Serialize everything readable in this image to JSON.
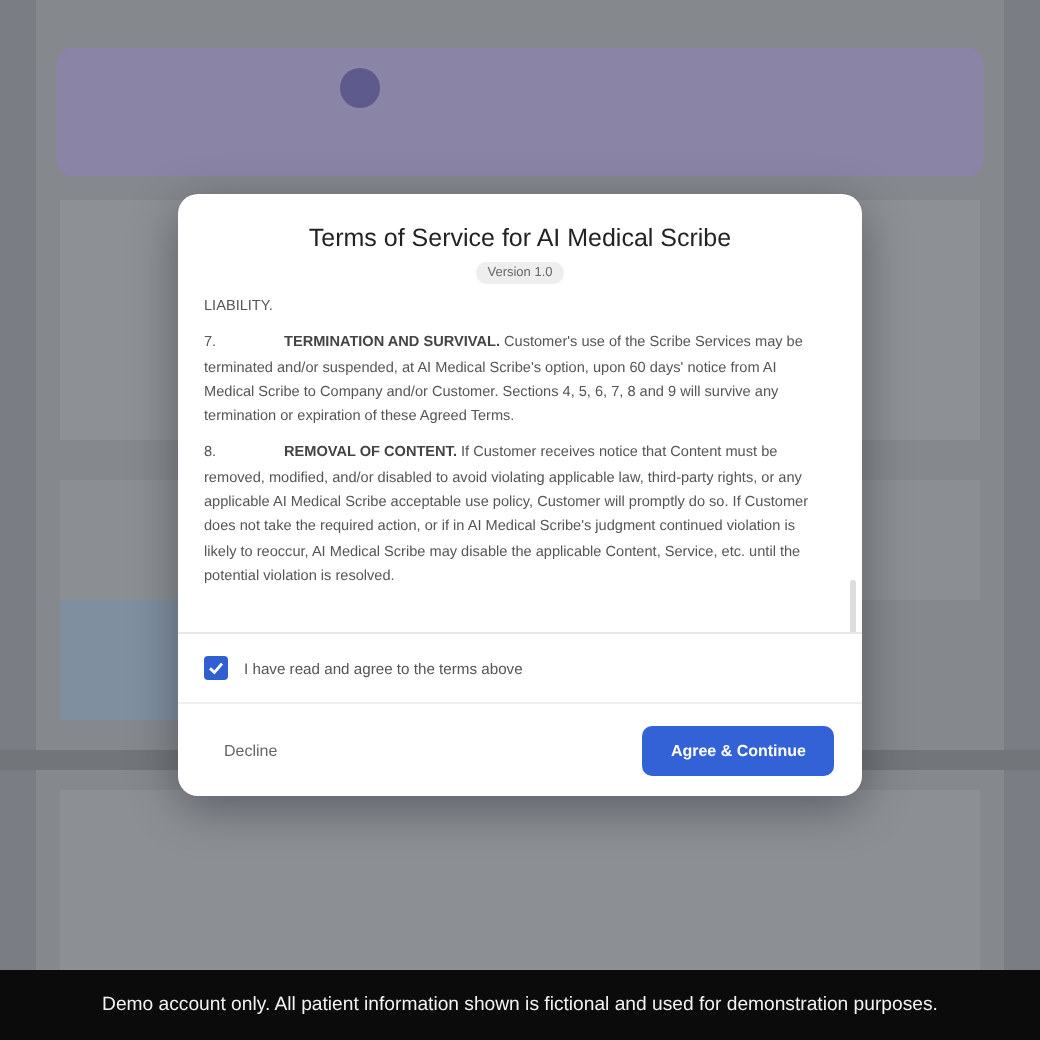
{
  "dialog": {
    "title": "Terms of Service for AI Medical Scribe",
    "version": "Version 1.0",
    "clauses": [
      {
        "text": "LIABILITY."
      },
      {
        "number": "7.",
        "text": "**TERMINATION AND SURVIVAL.** Customer's use of the Scribe Services may be terminated and/or suspended, at AI Medical Scribe's option, upon 60 days' notice from AI Medical Scribe to Company and/or Customer.  Sections 4, 5, 6, 7, 8 and 9 will survive any termination or expiration of these Agreed Terms."
      },
      {
        "number": "8.",
        "text": "**REMOVAL OF CONTENT.**  If Customer receives notice that Content must be removed, modified, and/or disabled to avoid violating applicable law, third-party rights, or any applicable AI Medical Scribe acceptable use policy, Customer will promptly do so. If Customer does not take the required action, or if in AI Medical Scribe's judgment continued violation is likely to reoccur, AI Medical Scribe may disable the applicable Content, Service, etc. until the potential violation is resolved."
      }
    ],
    "agreement": {
      "label": "I have read and agree to the terms above",
      "checked": true
    },
    "buttons": [
      {
        "label": "Decline",
        "kind": "secondary"
      },
      {
        "label": "Agree & Continue",
        "kind": "primary"
      }
    ]
  },
  "banner": "Demo account only. All patient information shown is fictional and used for demonstration purposes."
}
